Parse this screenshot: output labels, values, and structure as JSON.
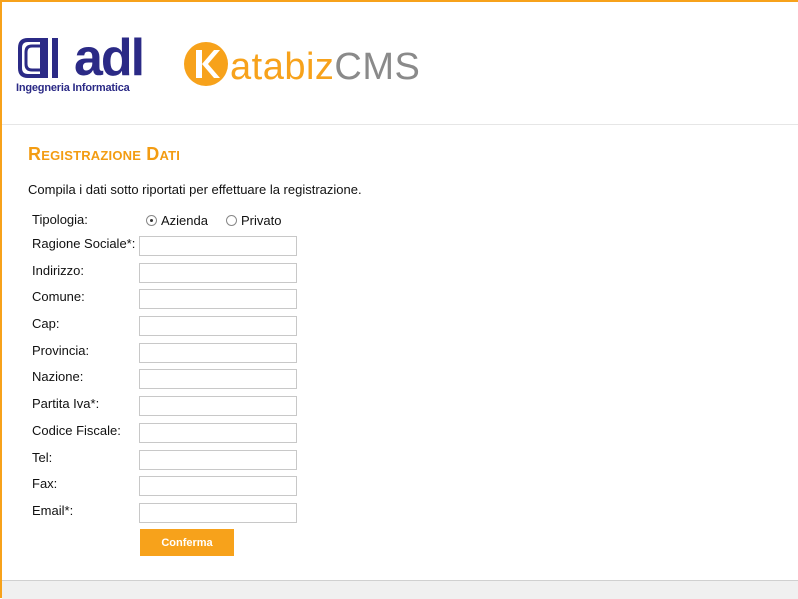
{
  "header": {
    "adl_word": "adl",
    "adl_tagline": "Ingegneria Informatica",
    "katabiz_word": "atabiz",
    "katabiz_cms": "CMS"
  },
  "page": {
    "title": "Registrazione Dati",
    "intro": "Compila i dati sotto riportati per effettuare la registrazione."
  },
  "form": {
    "tipologia_label": "Tipologia:",
    "options": [
      {
        "label": "Azienda",
        "selected": true
      },
      {
        "label": "Privato",
        "selected": false
      }
    ],
    "fields": [
      {
        "label": "Ragione Sociale*:",
        "value": ""
      },
      {
        "label": "Indirizzo:",
        "value": ""
      },
      {
        "label": "Comune:",
        "value": ""
      },
      {
        "label": "Cap:",
        "value": ""
      },
      {
        "label": "Provincia:",
        "value": ""
      },
      {
        "label": "Nazione:",
        "value": ""
      },
      {
        "label": "Partita Iva*:",
        "value": ""
      },
      {
        "label": "Codice Fiscale:",
        "value": ""
      },
      {
        "label": "Tel:",
        "value": ""
      },
      {
        "label": "Fax:",
        "value": ""
      },
      {
        "label": "Email*:",
        "value": ""
      }
    ],
    "submit_label": "Conferma"
  },
  "colors": {
    "accent": "#f7a21b",
    "brand_blue": "#2b2a86",
    "cms_gray": "#8a8a8a"
  }
}
